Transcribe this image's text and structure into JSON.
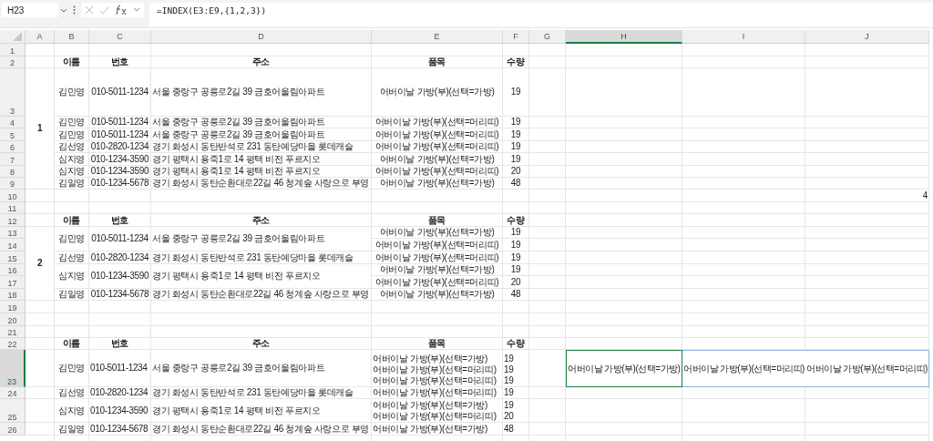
{
  "name_box": "H23",
  "formula": "=INDEX(E3:E9,{1,2,3})",
  "columns": [
    {
      "label": "A",
      "selected": false
    },
    {
      "label": "B",
      "selected": false
    },
    {
      "label": "C",
      "selected": false
    },
    {
      "label": "D",
      "selected": false
    },
    {
      "label": "E",
      "selected": false
    },
    {
      "label": "F",
      "selected": false
    },
    {
      "label": "G",
      "selected": false
    },
    {
      "label": "H",
      "selected": true
    },
    {
      "label": "I",
      "selected": false
    },
    {
      "label": "J",
      "selected": false
    }
  ],
  "row_numbers": [
    {
      "label": "1",
      "selected": false
    },
    {
      "label": "2",
      "selected": false
    },
    {
      "label": "3",
      "selected": false
    },
    {
      "label": "4",
      "selected": false
    },
    {
      "label": "5",
      "selected": false
    },
    {
      "label": "6",
      "selected": false
    },
    {
      "label": "7",
      "selected": false
    },
    {
      "label": "8",
      "selected": false
    },
    {
      "label": "9",
      "selected": false
    },
    {
      "label": "10",
      "selected": false
    },
    {
      "label": "11",
      "selected": false
    },
    {
      "label": "12",
      "selected": false
    },
    {
      "label": "13",
      "selected": false
    },
    {
      "label": "14",
      "selected": false
    },
    {
      "label": "15",
      "selected": false
    },
    {
      "label": "16",
      "selected": false
    },
    {
      "label": "17",
      "selected": false
    },
    {
      "label": "18",
      "selected": false
    },
    {
      "label": "19",
      "selected": false
    },
    {
      "label": "20",
      "selected": false
    },
    {
      "label": "21",
      "selected": false
    },
    {
      "label": "22",
      "selected": false
    },
    {
      "label": "23",
      "selected": true
    },
    {
      "label": "24",
      "selected": false
    },
    {
      "label": "25",
      "selected": false
    },
    {
      "label": "26",
      "selected": false
    }
  ],
  "blocks": [
    {
      "kind": "merged",
      "group_label": "1",
      "headers": [
        "이름",
        "번호",
        "주소",
        "품목",
        "수량"
      ],
      "records": [
        {
          "name": "김민영",
          "phone": "010-5011-1234",
          "address": "서울 중랑구 공릉로2길 39 금호어울림아파트",
          "items": [
            {
              "item": "어버이날 가방(부)(선택=가방)",
              "qty": "19"
            }
          ]
        },
        {
          "name": "김민영",
          "phone": "010-5011-1234",
          "address": "서울 중랑구 공릉로2길 39 금호어울림아파트",
          "items": [
            {
              "item": "어버이날 가방(부)(선택=머리띠)",
              "qty": "19"
            }
          ]
        },
        {
          "name": "김민영",
          "phone": "010-5011-1234",
          "address": "서울 중랑구 공릉로2길 39 금호어울림아파트",
          "items": [
            {
              "item": "어버이날 가방(부)(선택=머리띠)",
              "qty": "19"
            }
          ]
        },
        {
          "name": "김선영",
          "phone": "010-2820-1234",
          "address": "경기 화성시 동탄반석로 231 동탄예당마을 롯데캐슬",
          "items": [
            {
              "item": "어버이날 가방(부)(선택=머리띠)",
              "qty": "19"
            }
          ]
        },
        {
          "name": "심지영",
          "phone": "010-1234-3590",
          "address": "경기 평택시 용죽1로 14 평택 비전 푸르지오",
          "items": [
            {
              "item": "어버이날 가방(부)(선택=가방)",
              "qty": "19"
            }
          ]
        },
        {
          "name": "심지영",
          "phone": "010-1234-3590",
          "address": "경기 평택시 용죽1로 14 평택 비전 푸르지오",
          "items": [
            {
              "item": "어버이날 가방(부)(선택=머리띠)",
              "qty": "20"
            }
          ]
        },
        {
          "name": "김일영",
          "phone": "010-1234-5678",
          "address": "경기 화성시 동탄순환대로22길 46 청계숲 사랑으로 부영",
          "items": [
            {
              "item": "어버이날 가방(부)(선택=가방)",
              "qty": "48"
            }
          ]
        }
      ]
    },
    {
      "kind": "merged",
      "group_label": "2",
      "headers": [
        "이름",
        "번호",
        "주소",
        "품목",
        "수량"
      ],
      "records": [
        {
          "name": "김민영",
          "phone": "010-5011-1234",
          "address": "서울 중랑구 공릉로2길 39 금호어울림아파트",
          "items": [
            {
              "item": "어버이날 가방(부)(선택=가방)",
              "qty": "19"
            },
            {
              "item": "어버이날 가방(부)(선택=머리띠)",
              "qty": "19"
            }
          ]
        },
        {
          "name": "김선영",
          "phone": "010-2820-1234",
          "address": "경기 화성시 동탄반석로 231 동탄예당마을 롯데캐슬",
          "items": [
            {
              "item": "어버이날 가방(부)(선택=머리띠)",
              "qty": "19"
            }
          ]
        },
        {
          "name": "심지영",
          "phone": "010-1234-3590",
          "address": "경기 평택시 용죽1로 14 평택 비전 푸르지오",
          "items": [
            {
              "item": "어버이날 가방(부)(선택=가방)",
              "qty": "19"
            },
            {
              "item": "어버이날 가방(부)(선택=머리띠)",
              "qty": "20"
            }
          ]
        },
        {
          "name": "김일영",
          "phone": "010-1234-5678",
          "address": "경기 화성시 동탄순환대로22길 46 청계숲 사랑으로 부영",
          "items": [
            {
              "item": "어버이날 가방(부)(선택=가방)",
              "qty": "48"
            }
          ]
        }
      ]
    },
    {
      "kind": "wrapped",
      "headers": [
        "이름",
        "번호",
        "주소",
        "품목",
        "수량"
      ],
      "records": [
        {
          "name": "김민영",
          "phone": "010-5011-1234",
          "address": "서울 중랑구 공릉로2길 39 금호어울림아파트",
          "items": [
            {
              "item": "어버이날 가방(부)(선택=가방)",
              "qty": "19"
            },
            {
              "item": "어버이날 가방(부)(선택=머리띠)",
              "qty": "19"
            },
            {
              "item": "어버이날 가방(부)(선택=머리띠)",
              "qty": "19"
            }
          ]
        },
        {
          "name": "김선영",
          "phone": "010-2820-1234",
          "address": "경기 화성시 동탄반석로 231 동탄예당마을 롯데캐슬",
          "items": [
            {
              "item": "어버이날 가방(부)(선택=머리띠)",
              "qty": "19"
            }
          ]
        },
        {
          "name": "심지영",
          "phone": "010-1234-3590",
          "address": "경기 평택시 용죽1로 14 평택 비전 푸르지오",
          "items": [
            {
              "item": "어버이날 가방(부)(선택=가방)",
              "qty": "19"
            },
            {
              "item": "어버이날 가방(부)(선택=머리띠)",
              "qty": "20"
            }
          ]
        },
        {
          "name": "김일영",
          "phone": "010-1234-5678",
          "address": "경기 화성시 동탄순환대로22길 46 청계숲 사랑으로 부영",
          "items": [
            {
              "item": "어버이날 가방(부)(선택=가방)",
              "qty": "48"
            }
          ]
        }
      ],
      "spill": [
        {
          "text": "어버이날 가방(부)(선택=가방)",
          "selected": true
        },
        {
          "text": "어버이날 가방(부)(선택=머리띠)",
          "selected": false
        },
        {
          "text": "어버이날 가방(부)(선택=머리띠)",
          "selected": false
        }
      ]
    }
  ],
  "loose_values": [
    "4"
  ]
}
